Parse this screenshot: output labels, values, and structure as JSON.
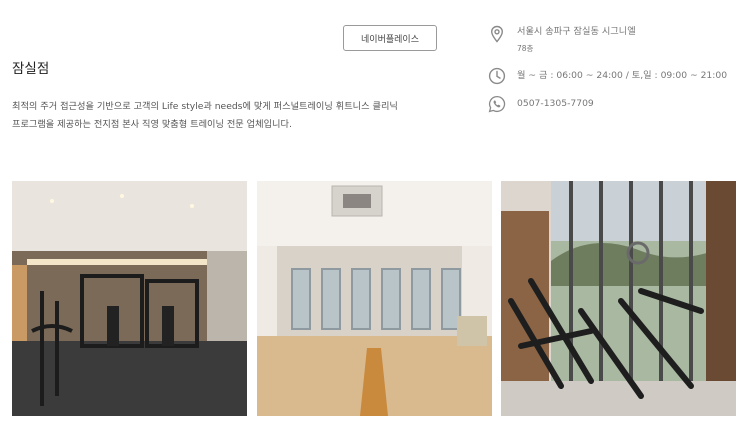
{
  "branch": {
    "title": "잠실점"
  },
  "naver_button": {
    "label": "네이버플레이스"
  },
  "description": {
    "line1": "최적의 주거 접근성을 기반으로 고객의 Life style과 needs에 맞게 퍼스널트레이닝 휘트니스 클리닉",
    "line2": "프로그램을 제공하는 전지점 본사 직영 맞춤형 트레이닝 전문 업체입니다."
  },
  "info": {
    "address": {
      "icon": "location-pin-icon",
      "line1": "서울시 송파구 잠실동 시그니엘",
      "line2": "78층"
    },
    "hours": {
      "icon": "clock-icon",
      "text": "월 ~ 금 : 06:00 ~ 24:00 / 토,일 : 09:00 ~ 21:00"
    },
    "phone": {
      "icon": "phone-icon",
      "text": "0507-1305-7709"
    }
  },
  "colors": {
    "icon_gray": "#8a8a8a",
    "border_gray": "#9a9a9a",
    "text_gray": "#777777"
  }
}
